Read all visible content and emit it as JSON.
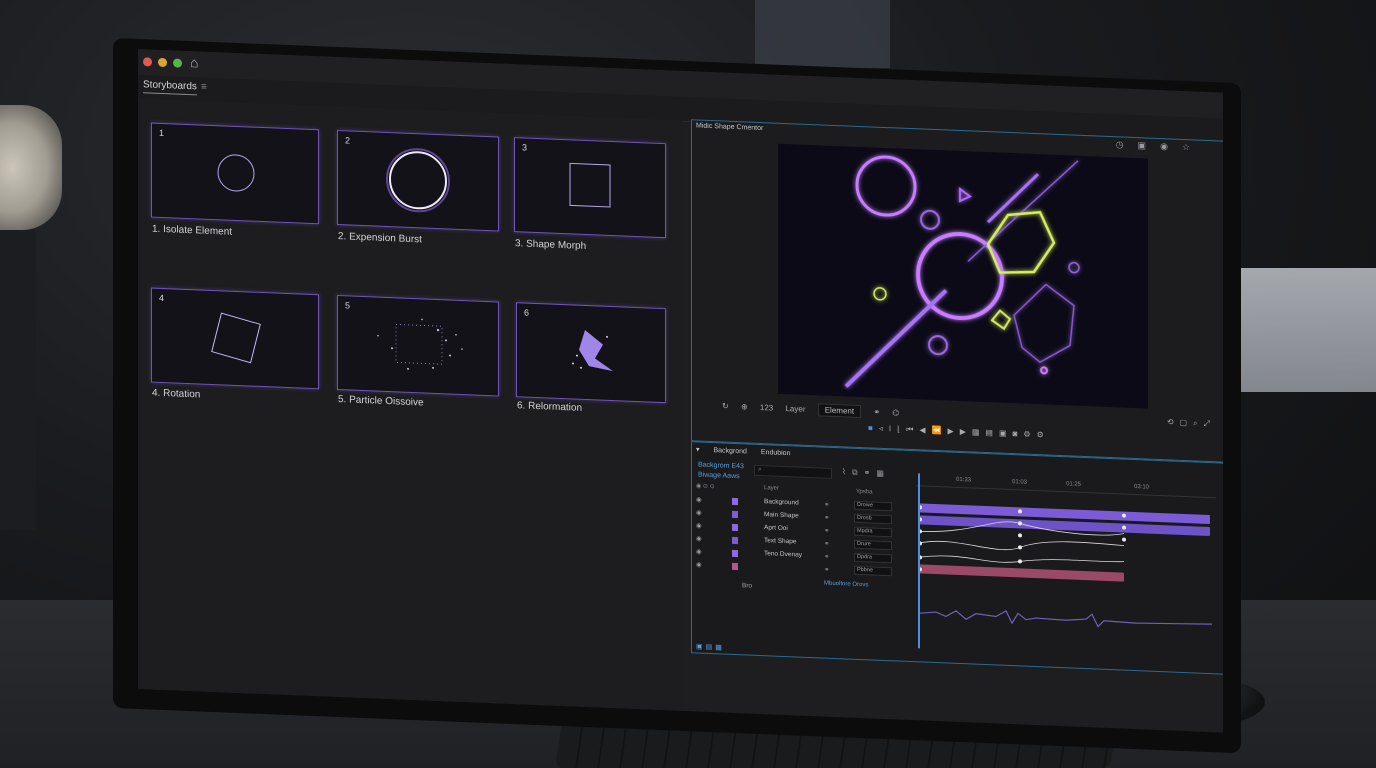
{
  "window": {
    "home_icon": "home-icon"
  },
  "storyboards": {
    "tab_label": "Storyboards",
    "menu_icon": "≡",
    "frames": [
      {
        "number": "1",
        "label": "1. Isolate Element"
      },
      {
        "number": "2",
        "label": "2. Expension Burst"
      },
      {
        "number": "3",
        "label": "3. Shape Morph"
      },
      {
        "number": "4",
        "label": "4. Rotation"
      },
      {
        "number": "5",
        "label": "5. Particle Oissoive"
      },
      {
        "number": "6",
        "label": "6. Relormation"
      }
    ]
  },
  "preview": {
    "title": "Midic Shape Cmentor",
    "frame_number": "123",
    "layer_label": "Layer",
    "element_select": "Element",
    "colors": {
      "accent": "#b46cff",
      "lime": "#d6ef5a",
      "border": "#2c6a8e"
    }
  },
  "timeline": {
    "tabs": [
      "Backgrond",
      "Endubion"
    ],
    "meta_line1": "Backgrom E43",
    "meta_line2": "Biwage Aaws",
    "search_placeholder": "",
    "layers_header": "Layer",
    "mode_header": "Ypsha",
    "layers": [
      {
        "name": "Background",
        "mode": "Drowe",
        "color": "#8a6be0"
      },
      {
        "name": "Main Shape",
        "mode": "Drosb",
        "color": "#7e5ed6"
      },
      {
        "name": "Aprt Ooi",
        "mode": "Mpdra",
        "color": "#8a6be0"
      },
      {
        "name": "Text Shape",
        "mode": "Drure",
        "color": "#7a5cd4"
      },
      {
        "name": "Teno Dvenay",
        "mode": "Dpdra",
        "color": "#8a6be0"
      },
      {
        "name": "",
        "mode": "Pbbne",
        "color": "#b05a8a"
      }
    ],
    "audio_label": "Bro",
    "audio_meta": "Mbuolfore Orovs",
    "ruler_marks": [
      "",
      "01:33",
      "01:03",
      "01:25",
      "03:10"
    ]
  }
}
